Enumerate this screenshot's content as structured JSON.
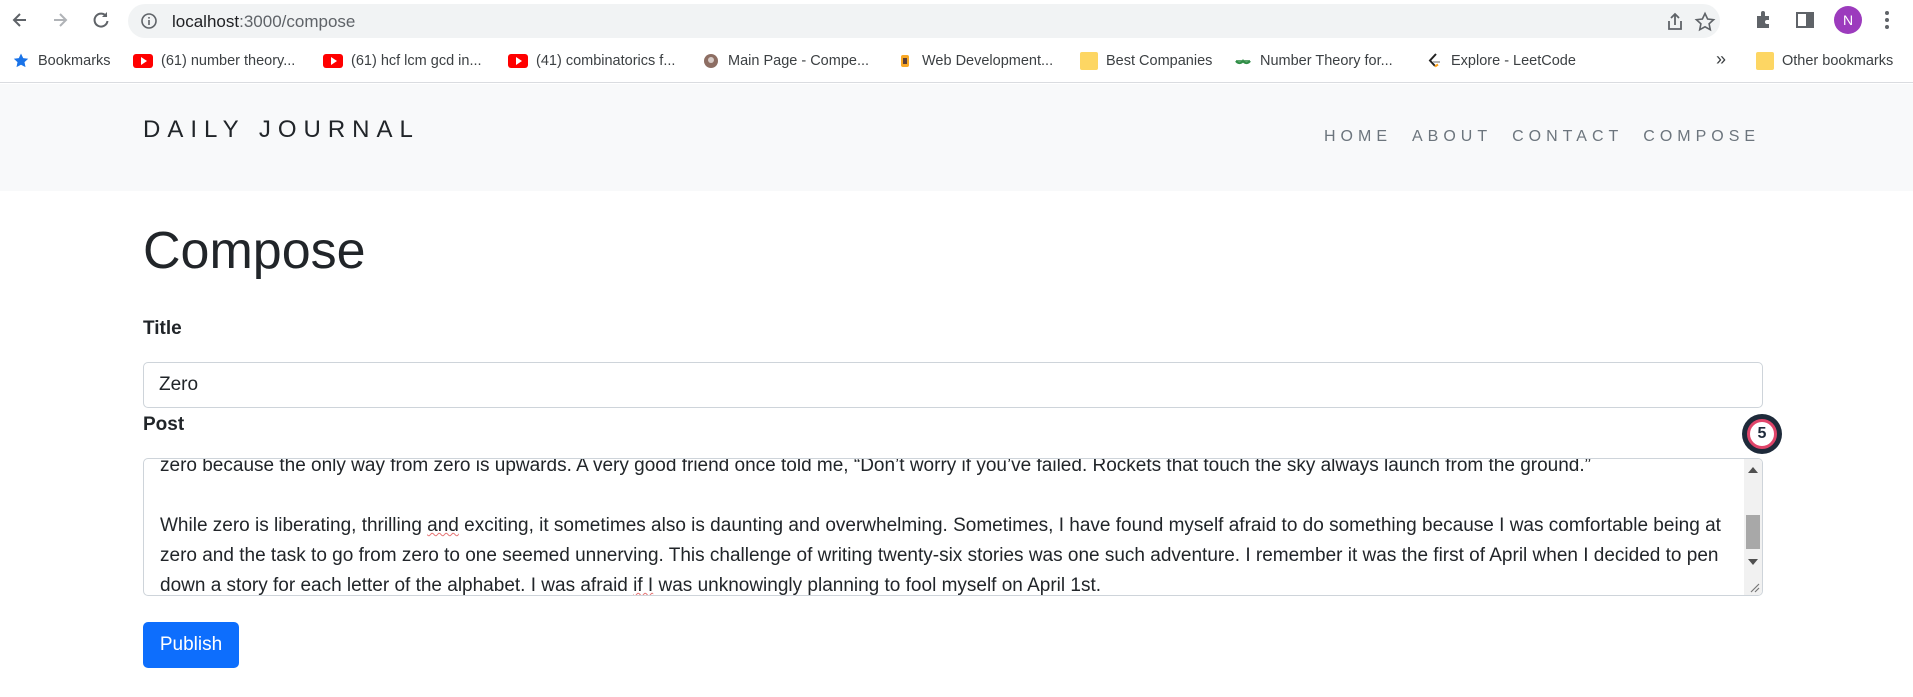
{
  "browser": {
    "url_host": "localhost",
    "url_path": ":3000/compose",
    "profile_initial": "N",
    "bookmarks": [
      {
        "label": "Bookmarks",
        "icon": "star-icon"
      },
      {
        "label": "(61) number theory...",
        "icon": "youtube-icon"
      },
      {
        "label": "(61) hcf lcm gcd in...",
        "icon": "youtube-icon"
      },
      {
        "label": "(41) combinatorics f...",
        "icon": "youtube-icon"
      },
      {
        "label": "Main Page - Compe...",
        "icon": "site-icon"
      },
      {
        "label": "Web Development...",
        "icon": "site-icon"
      },
      {
        "label": "Best Companies",
        "icon": "folder-icon"
      },
      {
        "label": "Number Theory for...",
        "icon": "geeksforgeeks-icon"
      },
      {
        "label": "Explore - LeetCode",
        "icon": "leetcode-icon"
      }
    ],
    "more_bookmarks": "»",
    "other_bookmarks": "Other bookmarks"
  },
  "site": {
    "brand": "DAILY JOURNAL",
    "nav": [
      "HOME",
      "ABOUT",
      "CONTACT",
      "COMPOSE"
    ]
  },
  "compose": {
    "heading": "Compose",
    "title_label": "Title",
    "title_value": "Zero",
    "post_label": "Post",
    "post_line_1": "zero because the only way from zero is upwards. A very good friend once told me, “Don’t worry if you’ve failed. Rockets that touch the sky always launch from the ground.”",
    "post_para_2_a": "While zero is liberating, thrilling ",
    "post_para_2_b": "and",
    "post_para_2_c": " exciting, it sometimes also is daunting and overwhelming. Sometimes, I have found myself afraid to do something because I was comfortable being at zero and the task to go from zero to one seemed unnerving. This challenge of writing twenty-six stories was one such adventure. I remember it was the first of April when I decided to pen down a story for each letter of the alphabet. I was afraid ",
    "post_para_2_d": "if I",
    "post_para_2_e": " was unknowingly planning to fool myself on April 1st.",
    "publish_label": "Publish"
  },
  "extension_badge": {
    "count": "5"
  },
  "colors": {
    "primary": "#0d6efd",
    "navbar_bg": "#f8f9fa",
    "badge_ring": "#e0456a"
  }
}
